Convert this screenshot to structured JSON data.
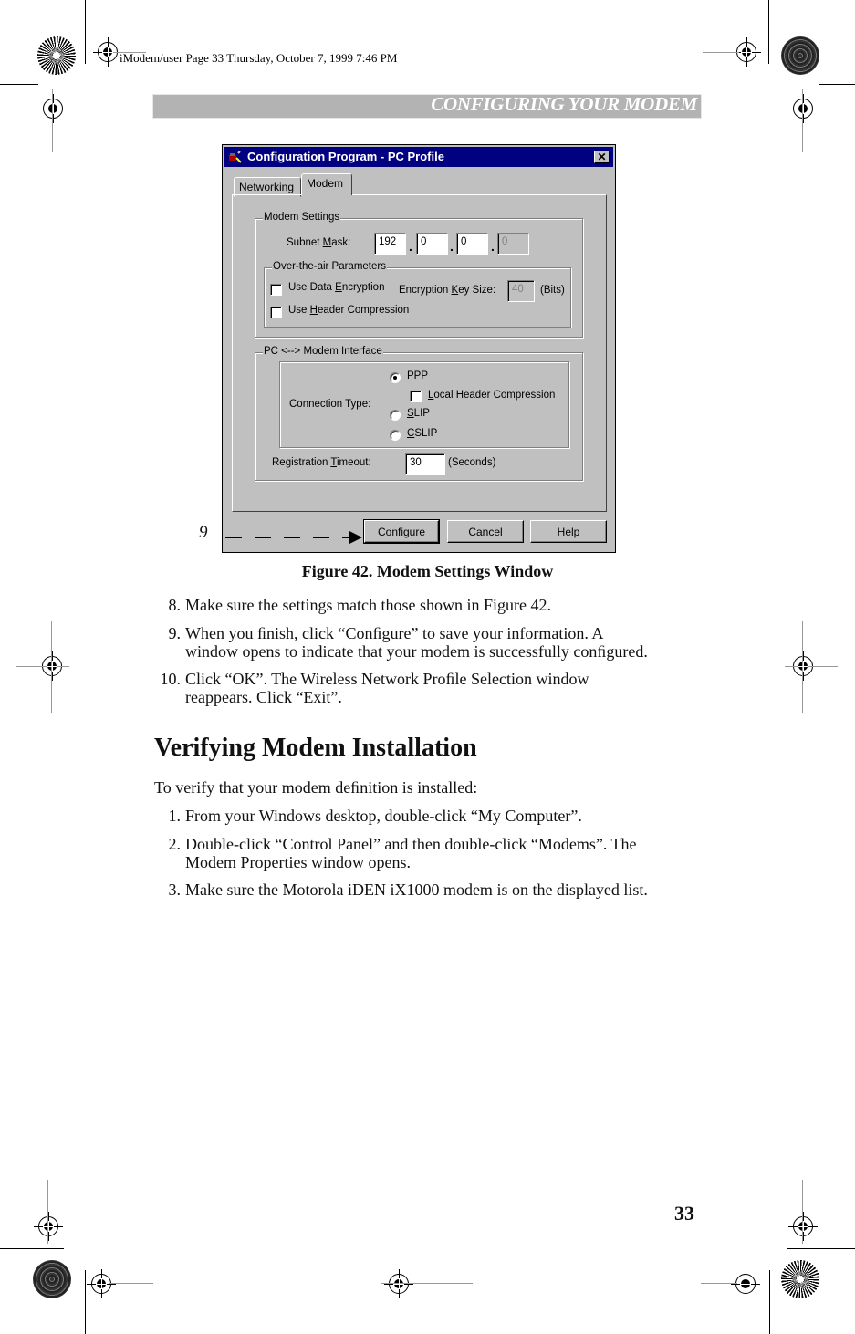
{
  "slug": "iModem/user  Page 33  Thursday, October 7, 1999  7:46 PM",
  "running_header": "CONFIGURING YOUR MODEM",
  "dialog": {
    "title": "Configuration Program - PC Profile",
    "close_glyph": "✕",
    "tabs": [
      {
        "label": "Networking",
        "selected": false
      },
      {
        "label": "Modem",
        "selected": true
      }
    ],
    "modem_settings": {
      "group_label": "Modem Settings",
      "subnet_mask_label": "Subnet Mask:",
      "subnet_mask": [
        "192",
        "0",
        "0",
        "0"
      ],
      "octet_separator": ".",
      "ota": {
        "group_label": "Over-the-air Parameters",
        "use_data_encryption_label": "Use Data Encryption",
        "use_data_encryption": false,
        "encryption_key_size_label": "Encryption Key Size:",
        "encryption_key_size": "40",
        "key_units": "(Bits)",
        "use_header_compression_label": "Use Header Compression",
        "use_header_compression": false
      }
    },
    "interface": {
      "group_label": "PC <--> Modem Interface",
      "connection_type_label": "Connection Type:",
      "options": [
        {
          "label": "PPP",
          "selected": true
        },
        {
          "label": "SLIP",
          "selected": false
        },
        {
          "label": "CSLIP",
          "selected": false
        }
      ],
      "local_header_compression_label": "Local Header Compression",
      "local_header_compression": false,
      "registration_timeout_label": "Registration Timeout:",
      "registration_timeout": "30",
      "timeout_units": "(Seconds)"
    },
    "buttons": {
      "configure": "Configure",
      "cancel": "Cancel",
      "help": "Help"
    }
  },
  "callout_number": "9",
  "figure_caption": "Figure 42. Modem Settings Window",
  "steps_a": [
    {
      "num": "8.",
      "lines": [
        "Make sure the settings match those shown in Figure 42."
      ]
    },
    {
      "num": "9.",
      "lines": [
        "When you ﬁnish, click “Conﬁgure” to save your information. A",
        "window opens to indicate that your modem is successfully conﬁgured."
      ]
    },
    {
      "num": "10.",
      "lines": [
        "Click “OK”. The Wireless Network Proﬁle Selection window",
        "reappears. Click “Exit”."
      ]
    }
  ],
  "section_heading": "Verifying Modem Installation",
  "intro": "To verify that your modem deﬁnition is installed:",
  "steps_b": [
    {
      "num": "1.",
      "lines": [
        "From your Windows desktop, double-click “My Computer”."
      ]
    },
    {
      "num": "2.",
      "lines": [
        "Double-click “Control Panel” and then double-click “Modems”. The",
        "Modem Properties window opens."
      ]
    },
    {
      "num": "3.",
      "lines": [
        "Make sure the Motorola iDEN iX1000 modem is on the displayed list."
      ]
    }
  ],
  "page_number": "33"
}
